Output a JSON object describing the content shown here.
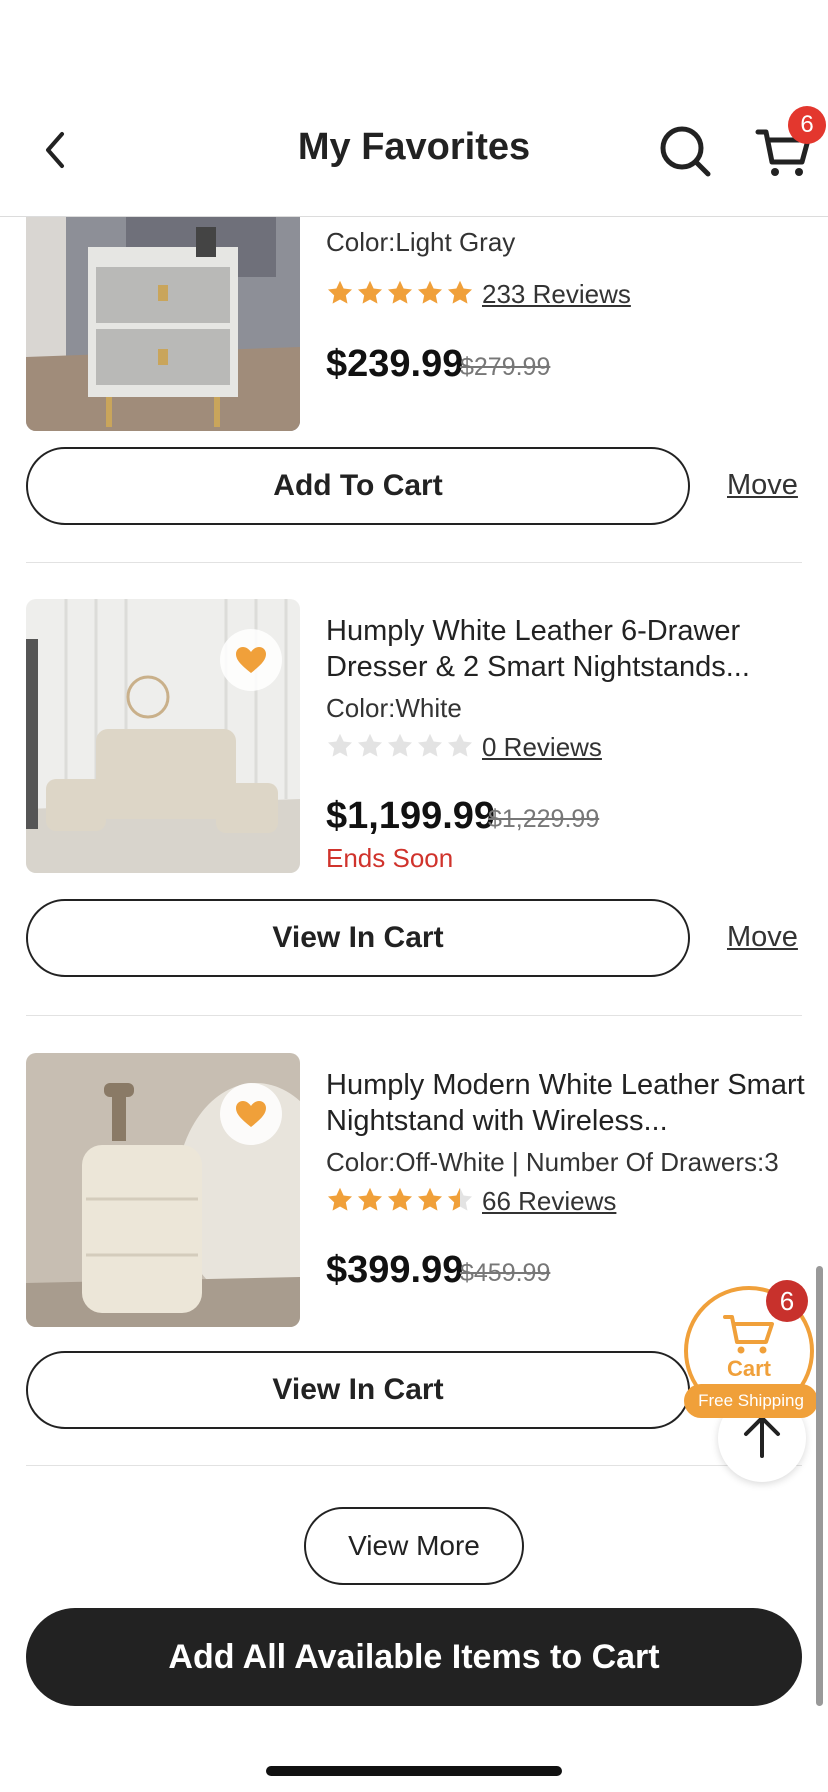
{
  "header": {
    "title": "My Favorites",
    "cart_count": "6"
  },
  "items": [
    {
      "title": "",
      "color": "Color:Light Gray",
      "rating": 5,
      "reviews": "233 Reviews",
      "price": "$239.99",
      "old_price": "$279.99",
      "button": "Add To Cart",
      "move": "Move"
    },
    {
      "title": "Humply White Leather 6-Drawer Dresser & 2 Smart Nightstands...",
      "color": "Color:White",
      "rating": 0,
      "reviews": "0 Reviews",
      "price": "$1,199.99",
      "old_price": "$1,229.99",
      "ends": "Ends Soon",
      "button": "View In Cart",
      "move": "Move"
    },
    {
      "title": "Humply Modern White Leather Smart Nightstand with Wireless...",
      "color": "Color:Off-White | Number Of Drawers:3",
      "rating": 4.5,
      "reviews": "66 Reviews",
      "price": "$399.99",
      "old_price": "$459.99",
      "button": "View In Cart"
    }
  ],
  "view_more": "View More",
  "add_all": "Add All Available Items to Cart",
  "floating_cart": {
    "label": "Cart",
    "badge": "6",
    "free_shipping": "Free Shipping"
  },
  "colors": {
    "accent": "#f0a03a",
    "badge": "#e3372e",
    "ends_soon": "#d0332c",
    "button_dark": "#222222"
  }
}
